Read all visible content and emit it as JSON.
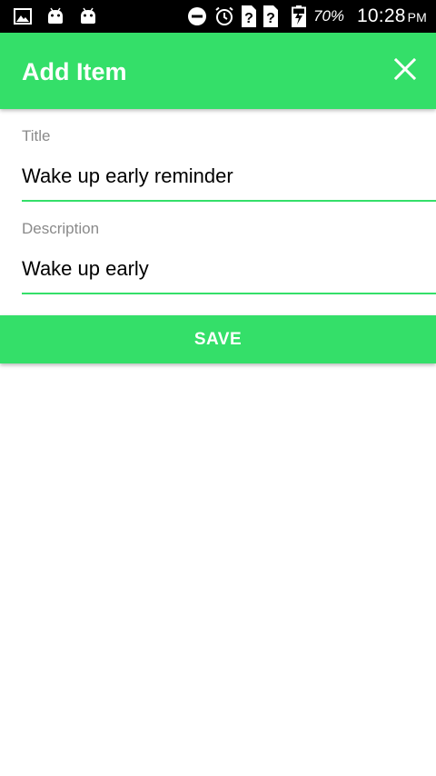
{
  "status_bar": {
    "left_icons": [
      "image-icon",
      "android-icon",
      "android-icon"
    ],
    "right_icons": [
      "do-not-disturb-icon",
      "alarm-icon",
      "unknown-sim-icon",
      "unknown-sim-icon",
      "battery-charging-icon"
    ],
    "battery": "70%",
    "time": "10:28",
    "ampm": "PM"
  },
  "app_bar": {
    "title": "Add Item",
    "close_icon": "close-icon",
    "color": "#34df69"
  },
  "form": {
    "title_label": "Title",
    "title_value": "Wake up early reminder",
    "description_label": "Description",
    "description_value": "Wake up early"
  },
  "save_button": {
    "label": "SAVE"
  },
  "colors": {
    "accent": "#34df69",
    "status_bar": "#000000",
    "label_gray": "#8a8a8a"
  }
}
